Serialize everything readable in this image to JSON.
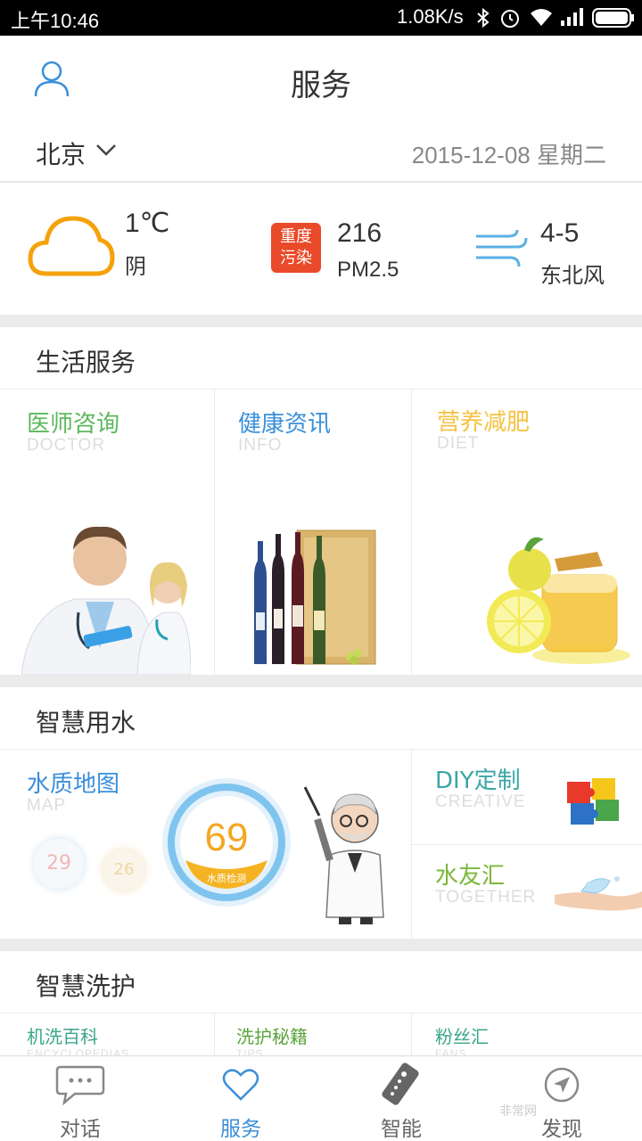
{
  "status_bar": {
    "time": "上午10:46",
    "speed": "1.08K/s"
  },
  "header": {
    "title": "服务"
  },
  "location": {
    "city": "北京",
    "date": "2015-12-08 星期二"
  },
  "weather": {
    "temperature": "1℃",
    "condition": "阴",
    "pollution_badge": [
      "重度",
      "污染"
    ],
    "pm_value": "216",
    "pm_label": "PM2.5",
    "wind_level": "4-5",
    "wind_dir": "东北风"
  },
  "life_services": {
    "title": "生活服务",
    "items": [
      {
        "cn": "医师咨询",
        "en": "DOCTOR",
        "color": "#5cb85c"
      },
      {
        "cn": "健康资讯",
        "en": "INFO",
        "color": "#3b8fd9"
      },
      {
        "cn": "营养减肥",
        "en": "DIET",
        "color": "#f5c242"
      }
    ]
  },
  "smart_water": {
    "title": "智慧用水",
    "map": {
      "cn": "水质地图",
      "en": "MAP",
      "score": "69",
      "score_label": "水质检测",
      "bubble1": "29",
      "bubble2": "26"
    },
    "diy": {
      "cn": "DIY定制",
      "en": "CREATIVE"
    },
    "together": {
      "cn": "水友汇",
      "en": "TOGETHER"
    }
  },
  "smart_wash": {
    "title": "智慧洗护",
    "items": [
      {
        "cn": "机洗百科",
        "en": "ENCYCLOPEDIAS"
      },
      {
        "cn": "洗护秘籍",
        "en": "TIPS"
      },
      {
        "cn": "粉丝汇",
        "en": "FANS"
      }
    ]
  },
  "tabs": [
    {
      "label": "对话",
      "icon": "chat-bubble-icon"
    },
    {
      "label": "服务",
      "icon": "heart-icon",
      "active": true
    },
    {
      "label": "智能",
      "icon": "remote-control-icon"
    },
    {
      "label": "发现",
      "icon": "compass-icon"
    }
  ],
  "watermark": "非常网"
}
